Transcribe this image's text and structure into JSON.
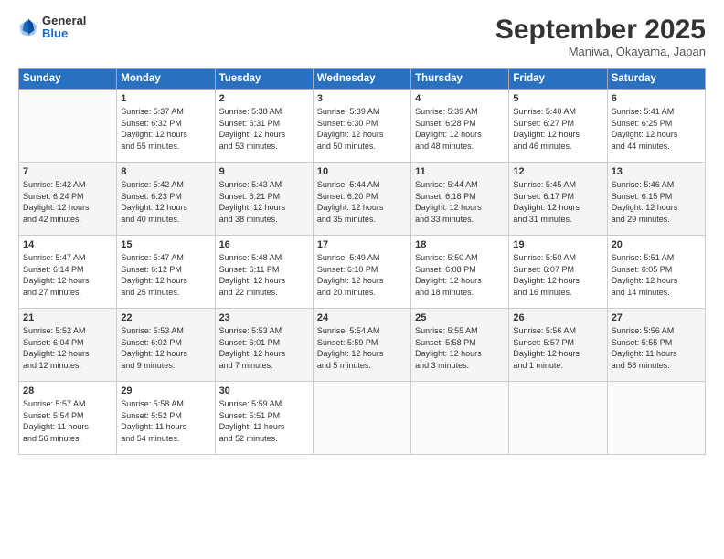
{
  "logo": {
    "general": "General",
    "blue": "Blue"
  },
  "title": "September 2025",
  "location": "Maniwa, Okayama, Japan",
  "days_of_week": [
    "Sunday",
    "Monday",
    "Tuesday",
    "Wednesday",
    "Thursday",
    "Friday",
    "Saturday"
  ],
  "weeks": [
    [
      {
        "day": "",
        "info": ""
      },
      {
        "day": "1",
        "info": "Sunrise: 5:37 AM\nSunset: 6:32 PM\nDaylight: 12 hours\nand 55 minutes."
      },
      {
        "day": "2",
        "info": "Sunrise: 5:38 AM\nSunset: 6:31 PM\nDaylight: 12 hours\nand 53 minutes."
      },
      {
        "day": "3",
        "info": "Sunrise: 5:39 AM\nSunset: 6:30 PM\nDaylight: 12 hours\nand 50 minutes."
      },
      {
        "day": "4",
        "info": "Sunrise: 5:39 AM\nSunset: 6:28 PM\nDaylight: 12 hours\nand 48 minutes."
      },
      {
        "day": "5",
        "info": "Sunrise: 5:40 AM\nSunset: 6:27 PM\nDaylight: 12 hours\nand 46 minutes."
      },
      {
        "day": "6",
        "info": "Sunrise: 5:41 AM\nSunset: 6:25 PM\nDaylight: 12 hours\nand 44 minutes."
      }
    ],
    [
      {
        "day": "7",
        "info": "Sunrise: 5:42 AM\nSunset: 6:24 PM\nDaylight: 12 hours\nand 42 minutes."
      },
      {
        "day": "8",
        "info": "Sunrise: 5:42 AM\nSunset: 6:23 PM\nDaylight: 12 hours\nand 40 minutes."
      },
      {
        "day": "9",
        "info": "Sunrise: 5:43 AM\nSunset: 6:21 PM\nDaylight: 12 hours\nand 38 minutes."
      },
      {
        "day": "10",
        "info": "Sunrise: 5:44 AM\nSunset: 6:20 PM\nDaylight: 12 hours\nand 35 minutes."
      },
      {
        "day": "11",
        "info": "Sunrise: 5:44 AM\nSunset: 6:18 PM\nDaylight: 12 hours\nand 33 minutes."
      },
      {
        "day": "12",
        "info": "Sunrise: 5:45 AM\nSunset: 6:17 PM\nDaylight: 12 hours\nand 31 minutes."
      },
      {
        "day": "13",
        "info": "Sunrise: 5:46 AM\nSunset: 6:15 PM\nDaylight: 12 hours\nand 29 minutes."
      }
    ],
    [
      {
        "day": "14",
        "info": "Sunrise: 5:47 AM\nSunset: 6:14 PM\nDaylight: 12 hours\nand 27 minutes."
      },
      {
        "day": "15",
        "info": "Sunrise: 5:47 AM\nSunset: 6:12 PM\nDaylight: 12 hours\nand 25 minutes."
      },
      {
        "day": "16",
        "info": "Sunrise: 5:48 AM\nSunset: 6:11 PM\nDaylight: 12 hours\nand 22 minutes."
      },
      {
        "day": "17",
        "info": "Sunrise: 5:49 AM\nSunset: 6:10 PM\nDaylight: 12 hours\nand 20 minutes."
      },
      {
        "day": "18",
        "info": "Sunrise: 5:50 AM\nSunset: 6:08 PM\nDaylight: 12 hours\nand 18 minutes."
      },
      {
        "day": "19",
        "info": "Sunrise: 5:50 AM\nSunset: 6:07 PM\nDaylight: 12 hours\nand 16 minutes."
      },
      {
        "day": "20",
        "info": "Sunrise: 5:51 AM\nSunset: 6:05 PM\nDaylight: 12 hours\nand 14 minutes."
      }
    ],
    [
      {
        "day": "21",
        "info": "Sunrise: 5:52 AM\nSunset: 6:04 PM\nDaylight: 12 hours\nand 12 minutes."
      },
      {
        "day": "22",
        "info": "Sunrise: 5:53 AM\nSunset: 6:02 PM\nDaylight: 12 hours\nand 9 minutes."
      },
      {
        "day": "23",
        "info": "Sunrise: 5:53 AM\nSunset: 6:01 PM\nDaylight: 12 hours\nand 7 minutes."
      },
      {
        "day": "24",
        "info": "Sunrise: 5:54 AM\nSunset: 5:59 PM\nDaylight: 12 hours\nand 5 minutes."
      },
      {
        "day": "25",
        "info": "Sunrise: 5:55 AM\nSunset: 5:58 PM\nDaylight: 12 hours\nand 3 minutes."
      },
      {
        "day": "26",
        "info": "Sunrise: 5:56 AM\nSunset: 5:57 PM\nDaylight: 12 hours\nand 1 minute."
      },
      {
        "day": "27",
        "info": "Sunrise: 5:56 AM\nSunset: 5:55 PM\nDaylight: 11 hours\nand 58 minutes."
      }
    ],
    [
      {
        "day": "28",
        "info": "Sunrise: 5:57 AM\nSunset: 5:54 PM\nDaylight: 11 hours\nand 56 minutes."
      },
      {
        "day": "29",
        "info": "Sunrise: 5:58 AM\nSunset: 5:52 PM\nDaylight: 11 hours\nand 54 minutes."
      },
      {
        "day": "30",
        "info": "Sunrise: 5:59 AM\nSunset: 5:51 PM\nDaylight: 11 hours\nand 52 minutes."
      },
      {
        "day": "",
        "info": ""
      },
      {
        "day": "",
        "info": ""
      },
      {
        "day": "",
        "info": ""
      },
      {
        "day": "",
        "info": ""
      }
    ]
  ]
}
